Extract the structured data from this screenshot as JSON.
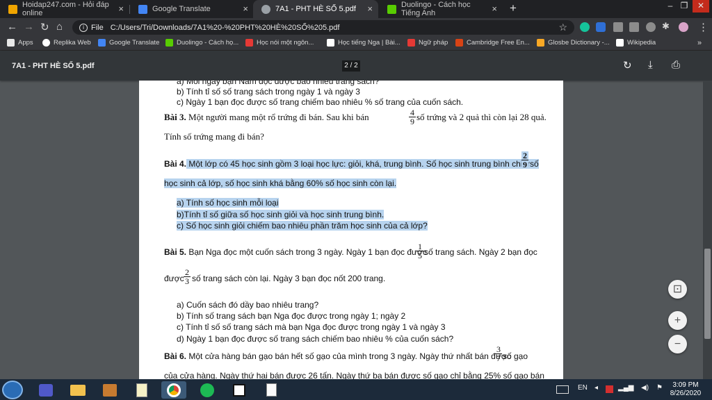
{
  "tabs": [
    {
      "title": "Hoidap247.com - Hỏi đáp online",
      "close": "×",
      "color": "#f0a500"
    },
    {
      "title": "Google Translate",
      "close": "×",
      "color": "#4285f4"
    },
    {
      "title": "7A1 - PHT HÈ SỐ 5.pdf",
      "close": "×",
      "color": "#9aa0a6"
    },
    {
      "title": "Duolingo - Cách học Tiếng Anh",
      "close": "×",
      "color": "#58cc02"
    }
  ],
  "new_tab": "+",
  "window_controls": {
    "minimize": "–",
    "restore": "❐",
    "close": "✕"
  },
  "address": {
    "scheme": "File",
    "url": "C:/Users/Tri/Downloads/7A1%20-%20PHT%20HÈ%20SỐ%205.pdf"
  },
  "bookmarks": [
    {
      "label": "Apps",
      "color": "#e8e8e8"
    },
    {
      "label": "Replika Web",
      "color": "#ffffff"
    },
    {
      "label": "Google Translate",
      "color": "#4285f4"
    },
    {
      "label": "Duolingo - Cách họ...",
      "color": "#58cc02"
    },
    {
      "label": "Học nói một ngôn...",
      "color": "#e53935"
    },
    {
      "label": "Học tiếng Nga | Bài...",
      "color": "#ffffff"
    },
    {
      "label": "Ngữ pháp",
      "color": "#e53935"
    },
    {
      "label": "Cambridge Free En...",
      "color": "#d84315"
    },
    {
      "label": "Glosbe Dictionary -...",
      "color": "#f9a825"
    },
    {
      "label": "Wikipedia",
      "color": "#ffffff"
    }
  ],
  "pdf": {
    "title": "7A1 - PHT HÈ SỐ 5.pdf",
    "page_indicator": "2 / 2"
  },
  "document": {
    "l1": "a)   Mỗi ngày bạn Nam đọc được bao nhiêu trang sách?",
    "l2": "b)   Tính tỉ số số trang sách trong ngày 1 và ngày 3",
    "l3": "c)   Ngày 1 bạn đọc được số trang chiếm bao nhiêu % số trang của cuốn sách.",
    "b3_label": "Bài 3.",
    "b3_text_a": " Một người mang một rổ trứng đi bán. Sau khi bán ",
    "b3_text_b": " số trứng và 2 quả thì còn lại 28 quả.",
    "b3_frac": {
      "num": "4",
      "den": "9"
    },
    "b3_line2": "Tính số trứng mang đi bán?",
    "b4_label": "Bài 4.",
    "b4_text": " Một lớp có 45 học sinh gồm 3 loại học lực: giỏi, khá, trung bình. Số học sinh trung bình chiếm ",
    "b4_frac": {
      "num": "2",
      "den": "9"
    },
    "b4_end": "số",
    "b4_line2": "học sinh cả lớp, số học sinh khá bằng 60% số học sinh còn lại.",
    "b4_a": "a)   Tính số học sinh mỗi loại",
    "b4_b": "b)Tính tỉ số giữa số học sinh giỏi và học sinh trung bình.",
    "b4_c": "c) Số học sinh giỏi chiếm bao nhiêu phần trăm học sinh của cả lớp?",
    "b5_label": "Bài 5.",
    "b5_text_a": " Bạn Nga đọc một cuốn sách trong 3 ngày. Ngày 1 bạn đọc được ",
    "b5_frac1": {
      "num": "1",
      "den": "5"
    },
    "b5_text_b": " số trang sách. Ngày 2 bạn đọc",
    "b5_line2_a": "được ",
    "b5_frac2": {
      "num": "2",
      "den": "3"
    },
    "b5_line2_b": "số trang sách còn lại. Ngày 3 bạn đọc nốt 200 trang.",
    "b5_a": "a)   Cuốn sách đó dầy bao nhiêu trang?",
    "b5_b": "b)   Tính số trang sách bạn Nga đọc được trong ngày 1; ngày 2",
    "b5_c": "c)   Tính tỉ số số trang sách mà bạn Nga đọc được trong ngày 1 và ngày 3",
    "b5_d": "d)   Ngày 1 bạn đọc được số trang sách chiếm bao nhiêu % của cuốn sách?",
    "b6_label": "Bài 6.",
    "b6_text_a": " Một cửa hàng bán gạo bán hết số gạo của mình trong 3 ngày. Ngày thứ nhất bán được ",
    "b6_frac": {
      "num": "3",
      "den": "7"
    },
    "b6_text_b": " số gạo",
    "b6_line2": "của cửa hàng. Ngày thứ hai bán được 26 tấn. Ngày thứ ba bán được số gạo chỉ bằng 25% số gạo bán"
  },
  "zoom": {
    "fit": "⊡",
    "in": "+",
    "out": "−"
  },
  "taskbar": {
    "lang": "EN",
    "time": "3:09 PM",
    "date": "8/26/2020"
  }
}
